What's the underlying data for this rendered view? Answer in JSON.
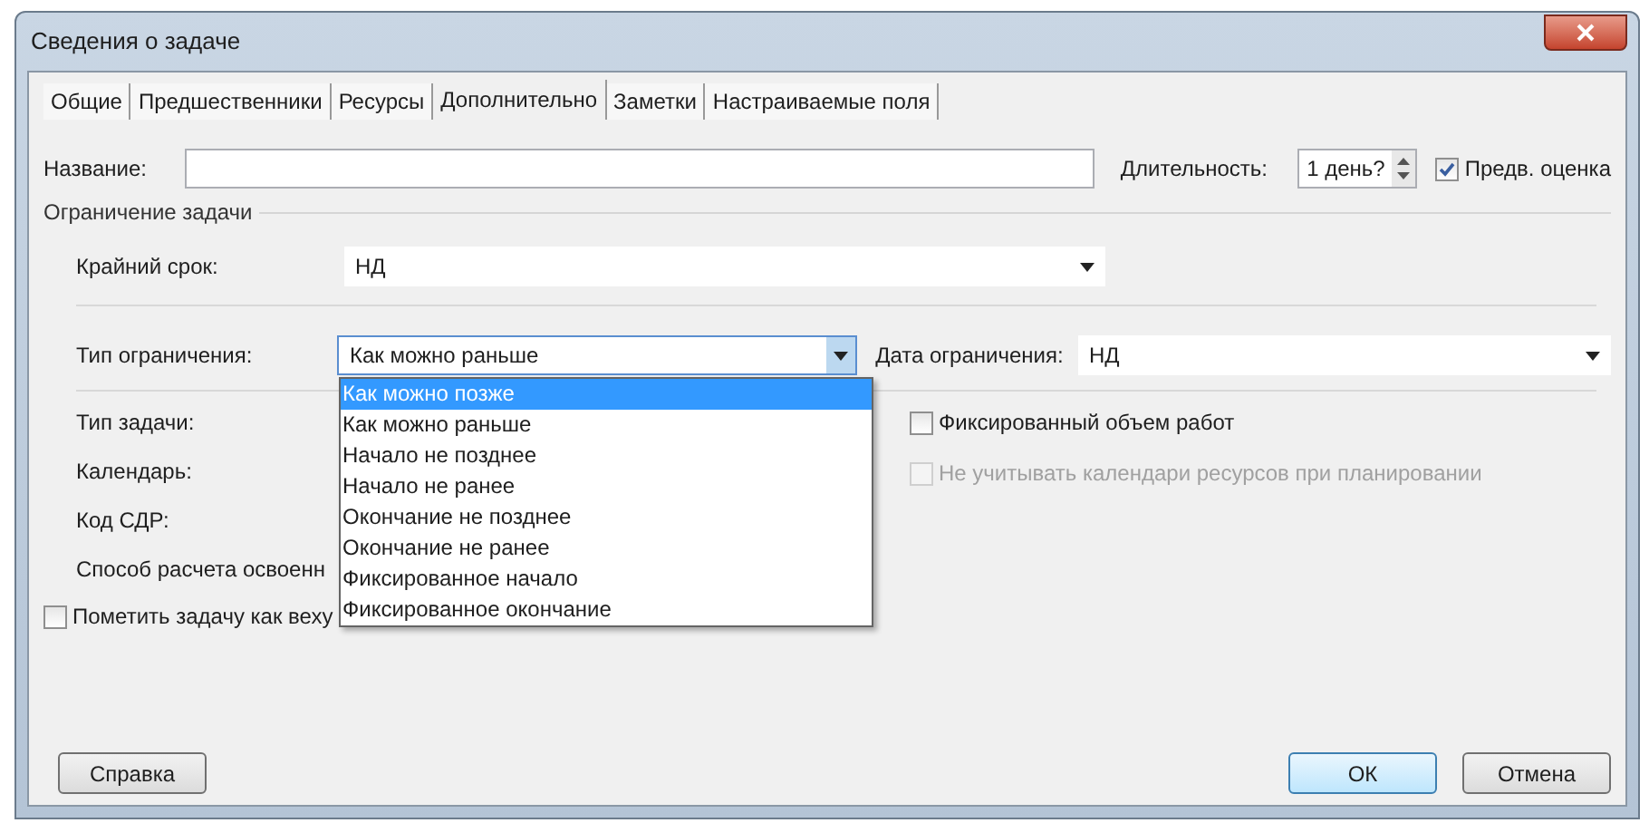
{
  "window": {
    "title": "Сведения о задаче"
  },
  "tabs": [
    {
      "label": "Общие",
      "selected": false
    },
    {
      "label": "Предшественники",
      "selected": false
    },
    {
      "label": "Ресурсы",
      "selected": false
    },
    {
      "label": "Дополнительно",
      "selected": true
    },
    {
      "label": "Заметки",
      "selected": false
    },
    {
      "label": "Настраиваемые поля",
      "selected": false
    }
  ],
  "name_field": {
    "label": "Название:"
  },
  "duration": {
    "label": "Длительность:",
    "value": "1 день?"
  },
  "estimated": {
    "label": "Предв. оценка",
    "checked": true
  },
  "constraint_group": {
    "title": "Ограничение задачи"
  },
  "deadline": {
    "label": "Крайний срок:",
    "value": "НД"
  },
  "constraint_type": {
    "label": "Тип ограничения:",
    "value": "Как можно раньше",
    "expanded": true,
    "options": [
      {
        "label": "Как можно позже",
        "highlighted": true
      },
      {
        "label": "Как можно раньше",
        "highlighted": false
      },
      {
        "label": "Начало не позднее",
        "highlighted": false
      },
      {
        "label": "Начало не ранее",
        "highlighted": false
      },
      {
        "label": "Окончание не позднее",
        "highlighted": false
      },
      {
        "label": "Окончание не ранее",
        "highlighted": false
      },
      {
        "label": "Фиксированное начало",
        "highlighted": false
      },
      {
        "label": "Фиксированное окончание",
        "highlighted": false
      }
    ]
  },
  "constraint_date": {
    "label": "Дата ограничения:",
    "value": "НД"
  },
  "left_labels": [
    "Тип задачи:",
    "Календарь:",
    "Код СДР:",
    "Способ расчета освоенн"
  ],
  "options": [
    {
      "label": "Фиксированный объем работ",
      "checked": false,
      "disabled": false
    },
    {
      "label": "Не учитывать календари ресурсов при планировании",
      "checked": false,
      "disabled": true
    }
  ],
  "milestone": {
    "label": "Пометить задачу как веху",
    "checked": false
  },
  "buttons": [
    {
      "label": "Справка",
      "default": false
    },
    {
      "label": "ОК",
      "default": true
    },
    {
      "label": "Отмена",
      "default": false
    }
  ]
}
